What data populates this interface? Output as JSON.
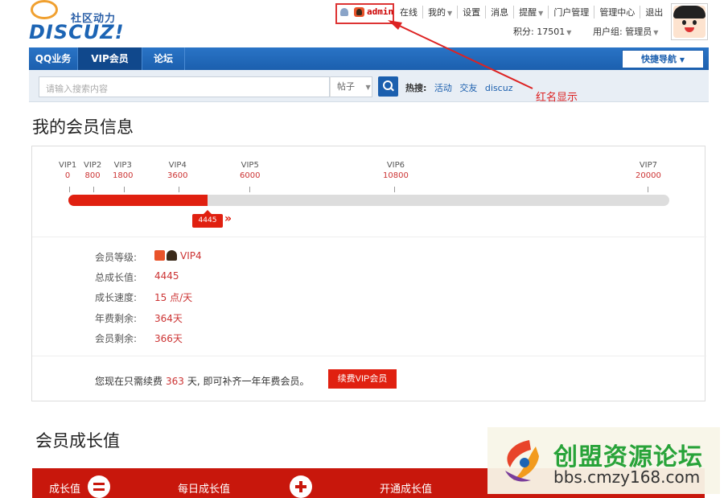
{
  "header": {
    "logo_slogan": "社区动力",
    "logo_brand": "DISCUZ!",
    "username": "admin",
    "topnav": [
      {
        "label": "在线",
        "dropdown": false
      },
      {
        "label": "我的",
        "dropdown": true
      },
      {
        "label": "设置",
        "dropdown": false
      },
      {
        "label": "消息",
        "dropdown": false
      },
      {
        "label": "提醒",
        "dropdown": true
      },
      {
        "label": "门户管理",
        "dropdown": false
      },
      {
        "label": "管理中心",
        "dropdown": false
      },
      {
        "label": "退出",
        "dropdown": false
      }
    ],
    "credits_label": "积分: 17501",
    "usergroup_label": "用户组: 管理员"
  },
  "navbar": {
    "items": [
      "QQ业务",
      "VIP会员",
      "论坛"
    ],
    "active_index": 1,
    "quicknav_label": "快捷导航"
  },
  "search": {
    "placeholder": "请输入搜索内容",
    "type_label": "帖子",
    "hot_label": "热搜:",
    "hot_terms": [
      "活动",
      "交友",
      "discuz"
    ]
  },
  "annotation": {
    "text": "红名显示",
    "color": "#dd2222"
  },
  "member": {
    "title": "我的会员信息",
    "levels": [
      {
        "name": "VIP1",
        "value": "0"
      },
      {
        "name": "VIP2",
        "value": "800"
      },
      {
        "name": "VIP3",
        "value": "1800"
      },
      {
        "name": "VIP4",
        "value": "3600"
      },
      {
        "name": "VIP5",
        "value": "6000"
      },
      {
        "name": "VIP6",
        "value": "10800"
      },
      {
        "name": "VIP7",
        "value": "20000"
      }
    ],
    "current_value": "4445",
    "progress_fraction": 0.232,
    "info": [
      {
        "label": "会员等级:",
        "value": "VIP4"
      },
      {
        "label": "总成长值:",
        "value": "4445"
      },
      {
        "label": "成长速度:",
        "value": "15 点/天"
      },
      {
        "label": "年费剩余:",
        "value": "364天"
      },
      {
        "label": "会员剩余:",
        "value": "366天"
      }
    ],
    "renew_text_before": "您现在只需续费",
    "renew_days": "363",
    "renew_text_after": "天, 即可补齐一年年费会员。",
    "renew_button": "续费VIP会员"
  },
  "growth": {
    "title": "会员成长值",
    "items": [
      "成长值",
      "每日成长值",
      "开通成长值"
    ]
  },
  "watermark": {
    "title": "创盟资源论坛",
    "url": "bbs.cmzy168.com"
  },
  "colors": {
    "brand_blue": "#1b5fae",
    "accent_red": "#e02010"
  }
}
